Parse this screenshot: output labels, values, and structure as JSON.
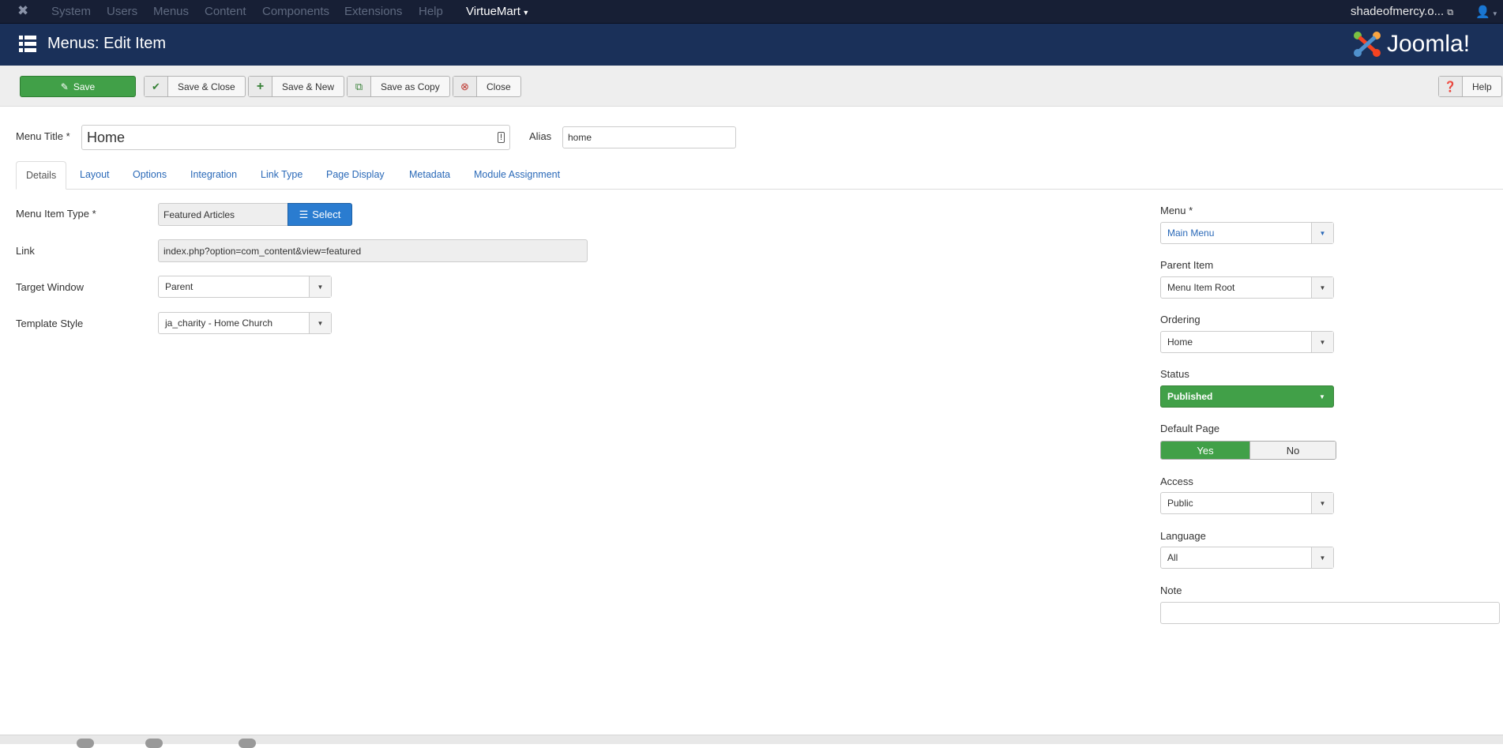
{
  "topnav": {
    "items": [
      "System",
      "Users",
      "Menus",
      "Content",
      "Components",
      "Extensions",
      "Help",
      "VirtueMart"
    ],
    "site": "shadeofmercy.o..."
  },
  "header": {
    "title": "Menus: Edit Item",
    "logo": "Joomla!"
  },
  "toolbar": {
    "save": "Save",
    "save_close": "Save & Close",
    "save_new": "Save & New",
    "save_copy": "Save as Copy",
    "close": "Close",
    "help": "Help"
  },
  "form": {
    "menu_title_label": "Menu Title *",
    "menu_title": "Home",
    "alias_label": "Alias",
    "alias": "home",
    "tabs": [
      "Details",
      "Layout",
      "Options",
      "Integration",
      "Link Type",
      "Page Display",
      "Metadata",
      "Module Assignment"
    ],
    "menu_item_type_label": "Menu Item Type *",
    "menu_item_type": "Featured Articles",
    "select_label": "Select",
    "link_label": "Link",
    "link": "index.php?option=com_content&view=featured",
    "target_window_label": "Target Window",
    "target_window": "Parent",
    "template_style_label": "Template Style",
    "template_style": "ja_charity - Home Church"
  },
  "side": {
    "menu_label": "Menu *",
    "menu": "Main Menu",
    "parent_label": "Parent Item",
    "parent": "Menu Item Root",
    "ordering_label": "Ordering",
    "ordering": "Home",
    "status_label": "Status",
    "status": "Published",
    "default_label": "Default Page",
    "yes": "Yes",
    "no": "No",
    "default_value": "Yes",
    "access_label": "Access",
    "access": "Public",
    "language_label": "Language",
    "language": "All",
    "note_label": "Note",
    "note": ""
  },
  "colors": {
    "green": "#41a048",
    "blue": "#2a7cd0",
    "nav": "#171f35",
    "header": "#1a3059"
  }
}
